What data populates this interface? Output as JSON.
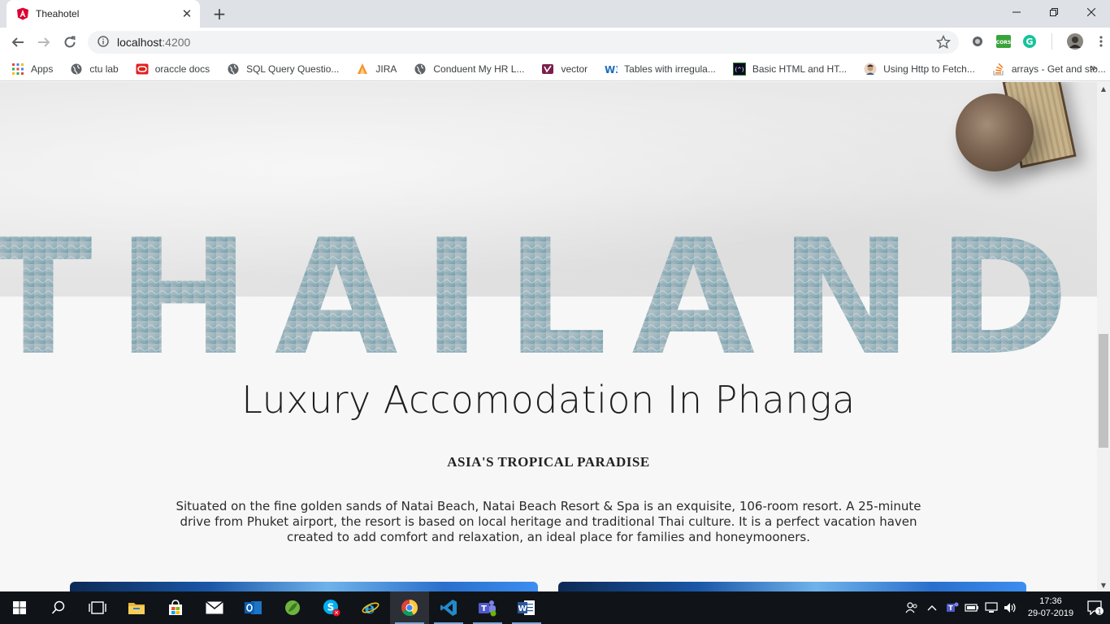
{
  "browser": {
    "tab": {
      "title": "Theahotel"
    },
    "url": {
      "host": "localhost",
      "port": ":4200"
    },
    "bookmarks": [
      {
        "label": "Apps",
        "icon": "apps-grid-icon"
      },
      {
        "label": "ctu lab",
        "icon": "globe-icon"
      },
      {
        "label": "oraccle docs",
        "icon": "oracle-icon"
      },
      {
        "label": "SQL Query Questio...",
        "icon": "globe-icon"
      },
      {
        "label": "JIRA",
        "icon": "jira-icon"
      },
      {
        "label": "Conduent My HR L...",
        "icon": "globe-icon"
      },
      {
        "label": "vector",
        "icon": "vector-icon"
      },
      {
        "label": "Tables with irregula...",
        "icon": "w3schools-icon"
      },
      {
        "label": "Basic HTML and HT...",
        "icon": "freecodecamp-icon"
      },
      {
        "label": "Using Http to Fetch...",
        "icon": "avatar-icon"
      },
      {
        "label": "arrays - Get and sto...",
        "icon": "stackoverflow-icon"
      }
    ]
  },
  "hero": {
    "headline": "THAILAND",
    "subtitle": "Luxury Accomodation In Phanga",
    "tagline": "ASIA'S TROPICAL PARADISE",
    "description_lines": [
      "Situated on the fine golden sands of Natai Beach, Natai Beach Resort & Spa is an exquisite, 106-room resort. A 25-minute",
      "drive from Phuket airport, the resort is based on local heritage and traditional Thai culture. It is a perfect vacation haven",
      "created to add comfort and relaxation, an ideal place for families and honeymooners."
    ]
  },
  "taskbar": {
    "time": "17:36",
    "date": "29-07-2019",
    "notification_count": "1"
  },
  "colors": {
    "tab_strip": "#dee1e6",
    "taskbar": "#101418",
    "text_dark": "#1e1e1e"
  }
}
